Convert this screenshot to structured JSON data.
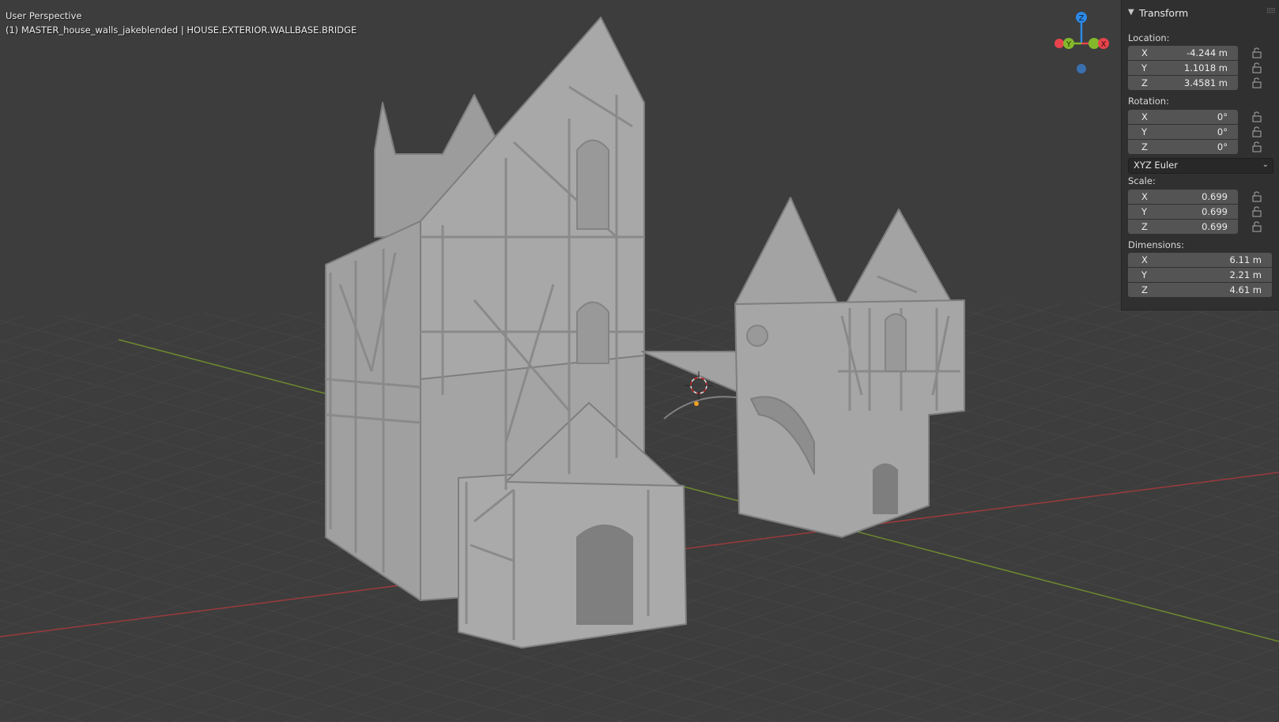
{
  "viewport": {
    "title": "User Perspective",
    "object_line": "(1) MASTER_house_walls_jakeblended | HOUSE.EXTERIOR.WALLBASE.BRIDGE"
  },
  "gizmo": {
    "z": "Z",
    "y": "Y",
    "x": "X",
    "colors": {
      "x": "#e8434d",
      "y": "#84b82b",
      "z": "#2c89e6",
      "neg_y": "#88b84a",
      "neg_z": "#3a6fae"
    }
  },
  "colors": {
    "background": "#3d3d3d",
    "grid": "#4a4a4a",
    "x_axis": "#9a3a3d",
    "y_axis": "#6c8a2e",
    "model": "#a3a3a3"
  },
  "transform_panel": {
    "header": "Transform",
    "location": {
      "label": "Location:",
      "x": {
        "axis": "X",
        "value": "-4.244 m"
      },
      "y": {
        "axis": "Y",
        "value": "1.1018 m"
      },
      "z": {
        "axis": "Z",
        "value": "3.4581 m"
      }
    },
    "rotation": {
      "label": "Rotation:",
      "x": {
        "axis": "X",
        "value": "0°"
      },
      "y": {
        "axis": "Y",
        "value": "0°"
      },
      "z": {
        "axis": "Z",
        "value": "0°"
      },
      "mode": "XYZ Euler"
    },
    "scale": {
      "label": "Scale:",
      "x": {
        "axis": "X",
        "value": "0.699"
      },
      "y": {
        "axis": "Y",
        "value": "0.699"
      },
      "z": {
        "axis": "Z",
        "value": "0.699"
      }
    },
    "dimensions": {
      "label": "Dimensions:",
      "x": {
        "axis": "X",
        "value": "6.11 m"
      },
      "y": {
        "axis": "Y",
        "value": "2.21 m"
      },
      "z": {
        "axis": "Z",
        "value": "4.61 m"
      }
    }
  }
}
